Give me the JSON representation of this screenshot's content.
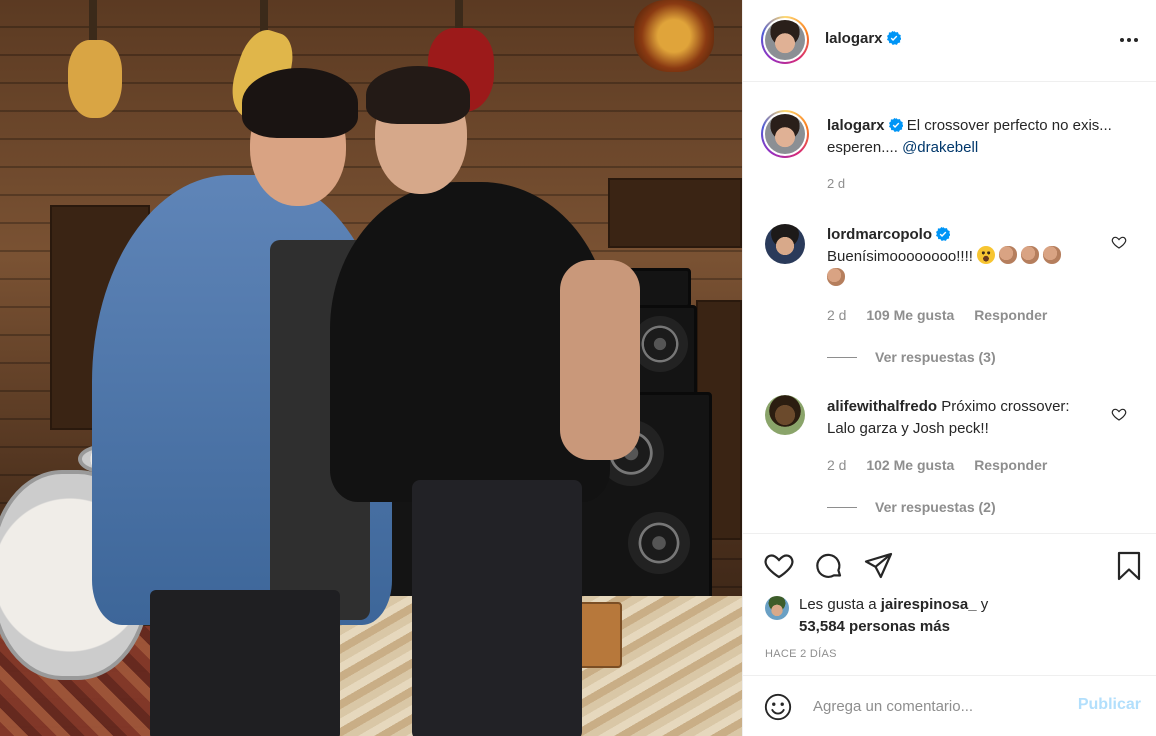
{
  "post": {
    "author": "lalogarx",
    "verified": true,
    "caption_text": "El crossover perfecto no exis... esperen....",
    "caption_mention": "@drakebell",
    "caption_time": "2 d"
  },
  "comments": [
    {
      "username": "lordmarcopolo",
      "verified": true,
      "text": "Buenísimoooooooo!!!!",
      "emojis": [
        "astonished-face",
        "clapping-hands",
        "clapping-hands",
        "clapping-hands",
        "clapping-hands"
      ],
      "time": "2 d",
      "likes": "109 Me gusta",
      "reply_label": "Responder",
      "view_replies": "Ver respuestas (3)"
    },
    {
      "username": "alifewithalfredo",
      "verified": false,
      "text": "Próximo crossover: Lalo garza y Josh peck!!",
      "time": "2 d",
      "likes": "102 Me gusta",
      "reply_label": "Responder",
      "view_replies": "Ver respuestas (2)"
    }
  ],
  "likes": {
    "prefix": "Les gusta a",
    "user": "jairespinosa_",
    "connector": "y",
    "count": "53,584 personas más"
  },
  "posted_ago": "HACE 2 DÍAS",
  "composer": {
    "placeholder": "Agrega un comentario...",
    "submit_label": "Publicar"
  },
  "icons": {
    "like": "heart-icon",
    "comment": "comment-icon",
    "share": "paper-plane-icon",
    "save": "bookmark-icon",
    "more": "more-options-icon",
    "emoji": "emoji-smile-icon",
    "verified": "verified-badge-icon"
  },
  "colors": {
    "verified": "#0095f6",
    "link": "#00376b",
    "muted": "#8e8e8e",
    "publish_disabled": "#b2dffc"
  }
}
